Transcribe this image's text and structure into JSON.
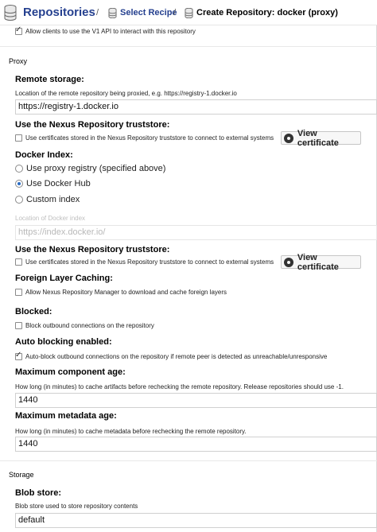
{
  "breadcrumb": {
    "root": "Repositories",
    "step": "Select Recipe",
    "current": "Create Repository: docker (proxy)",
    "separator": "/"
  },
  "v1_api": {
    "label": "Allow clients to use the V1 API to interact with this repository",
    "checked": true
  },
  "proxy": {
    "section_title": "Proxy",
    "remote_storage": {
      "label": "Remote storage:",
      "help": "Location of the remote repository being proxied, e.g. https://registry-1.docker.io",
      "value": "https://registry-1.docker.io"
    },
    "truststore_1": {
      "label": "Use the Nexus Repository truststore:",
      "checkbox_label": "Use certificates stored in the Nexus Repository truststore to connect to external systems",
      "checked": false,
      "button": "View certificate"
    },
    "docker_index": {
      "label": "Docker Index:",
      "options": [
        "Use proxy registry (specified above)",
        "Use Docker Hub",
        "Custom index"
      ],
      "selected": "Use Docker Hub",
      "location_label": "Location of Docker index",
      "location_value": "https://index.docker.io/"
    },
    "truststore_2": {
      "label": "Use the Nexus Repository truststore:",
      "checkbox_label": "Use certificates stored in the Nexus Repository truststore to connect to external systems",
      "checked": false,
      "button": "View certificate"
    },
    "foreign_layer": {
      "label": "Foreign Layer Caching:",
      "checkbox_label": "Allow Nexus Repository Manager to download and cache foreign layers",
      "checked": false
    },
    "blocked": {
      "label": "Blocked:",
      "checkbox_label": "Block outbound connections on the repository",
      "checked": false
    },
    "auto_blocking": {
      "label": "Auto blocking enabled:",
      "checkbox_label": "Auto-block outbound connections on the repository if remote peer is detected as unreachable/unresponsive",
      "checked": true
    },
    "max_component_age": {
      "label": "Maximum component age:",
      "help": "How long (in minutes) to cache artifacts before rechecking the remote repository. Release repositories should use -1.",
      "value": "1440"
    },
    "max_metadata_age": {
      "label": "Maximum metadata age:",
      "help": "How long (in minutes) to cache metadata before rechecking the remote repository.",
      "value": "1440"
    }
  },
  "storage": {
    "section_title": "Storage",
    "blob_store": {
      "label": "Blob store:",
      "help": "Blob store used to store repository contents",
      "value": "default"
    }
  },
  "colors": {
    "link": "#25408f",
    "radio_selected": "#2a6cc4"
  }
}
